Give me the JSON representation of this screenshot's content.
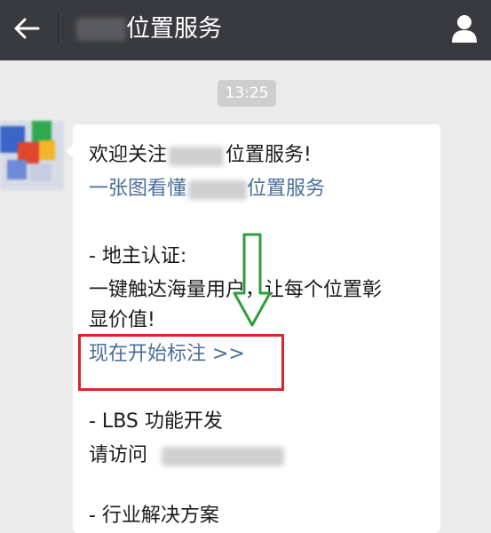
{
  "header": {
    "title": "位置服务",
    "back_icon": "back-arrow-icon",
    "profile_icon": "person-icon",
    "background": "#393a3f"
  },
  "chat": {
    "timestamp": "13:25",
    "message": {
      "line1_prefix": "欢迎关注",
      "line1_suffix": "位置服务!",
      "line2_prefix": "一张图看懂",
      "line2_suffix": "位置服务",
      "section1_title": "- 地主认证:",
      "section1_body_line1": "一键触达海量用户，让每个位置彰",
      "section1_body_line2": "显价值!",
      "section1_link": "现在开始标注 >>",
      "section2_title": "- LBS 功能开发",
      "section2_body_prefix": "请访问",
      "section3_title": "- 行业解决方案"
    }
  },
  "annotations": {
    "highlight_color": "#d9262c",
    "arrow_color": "#2e9e3c"
  }
}
